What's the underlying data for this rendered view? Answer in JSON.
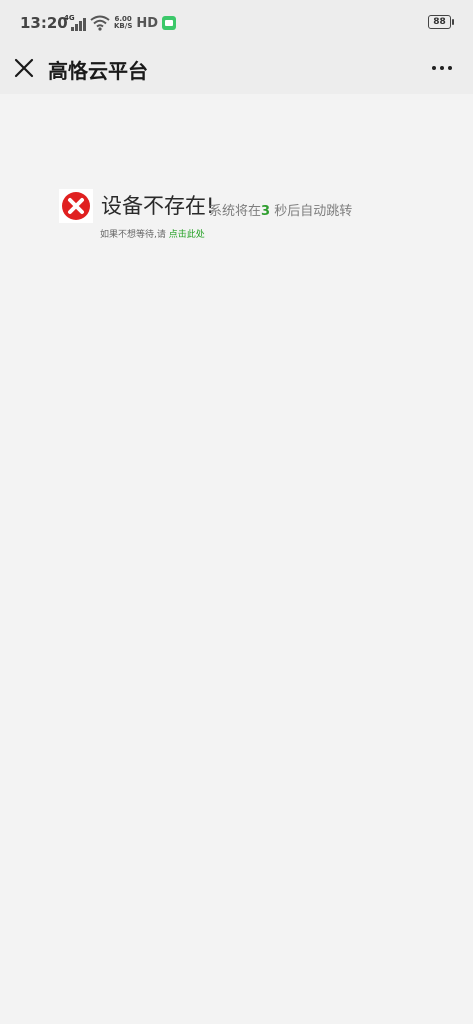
{
  "status_bar": {
    "time": "13:20",
    "network": "4G",
    "speed_value": "6.00",
    "speed_unit": "KB/S",
    "hd": "HD",
    "battery": "88"
  },
  "header": {
    "title": "高恪云平台",
    "close_icon": "close-icon",
    "more_icon": "more-icon"
  },
  "error": {
    "icon": "error-icon",
    "title": "设备不存在!",
    "sub_prefix": "系统将在",
    "countdown": "3",
    "sub_suffix": " 秒后自动跳转",
    "wait_prefix": "如果不想等待,请 ",
    "link_text": "点击此处"
  },
  "colors": {
    "background": "#f3f3f3",
    "header": "#ededed",
    "error_red": "#e02020",
    "link_green": "#22a022"
  }
}
